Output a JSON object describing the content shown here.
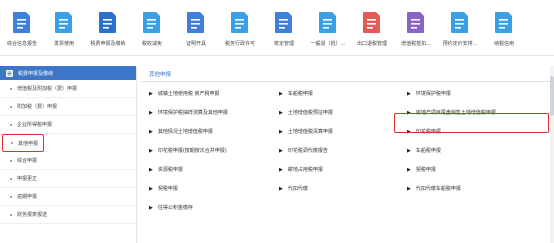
{
  "toolbar": {
    "items": [
      {
        "label": "综合信息报告",
        "color": "#3d7fd9",
        "icon": "doc-upload-icon"
      },
      {
        "label": "发票使用",
        "color": "#3aa0e6",
        "icon": "invoice-icon"
      },
      {
        "label": "税费申报及缴纳",
        "color": "#2d6fcc",
        "icon": "tax-declare-icon"
      },
      {
        "label": "税收减免",
        "color": "#3aa0e6",
        "icon": "tax-reduce-icon"
      },
      {
        "label": "证明开具",
        "color": "#3d7fd9",
        "icon": "certificate-icon"
      },
      {
        "label": "税务行政许可",
        "color": "#3aa0e6",
        "icon": "admin-permit-icon"
      },
      {
        "label": "核定管理",
        "color": "#3d7fd9",
        "icon": "approve-manage-icon"
      },
      {
        "label": "一般退（抵）...",
        "color": "#3aa0e6",
        "icon": "refund-icon"
      },
      {
        "label": "出口退税管理",
        "color": "#e25b54",
        "icon": "export-refund-icon"
      },
      {
        "label": "增值税抵扣...",
        "color": "#8a63c9",
        "icon": "vat-deduct-icon"
      },
      {
        "label": "预约定价安排...",
        "color": "#3aa0e6",
        "icon": "pricing-icon"
      },
      {
        "label": "纳税信用",
        "color": "#3aa0e6",
        "icon": "credit-icon"
      }
    ]
  },
  "sidebar": {
    "header": "税费申报及缴纳",
    "items": [
      {
        "label": "增值税及附加税（费）申报"
      },
      {
        "label": "附加税（费）申报"
      },
      {
        "label": "企业所得税申报"
      },
      {
        "label": "其他申报",
        "active": true
      },
      {
        "label": "综合申报"
      },
      {
        "label": "申报更正"
      },
      {
        "label": "逾期申报"
      },
      {
        "label": "财务报表报送"
      }
    ]
  },
  "main": {
    "header": "其他申报",
    "rows": [
      [
        "城镇土地使用税 房产税申报",
        "车船税申报",
        "环境保护税申报"
      ],
      [
        "环境保护税抽样测算及其他申报",
        "土地增值税预征申报",
        "房地产项目尾盘销售土地增值税申报"
      ],
      [
        "其他情况土地增值税申报",
        "土地增值税清算申报",
        "印花税申报"
      ],
      [
        "印花税申报(按期按次合并申报)",
        "印花税调代缴报告",
        "车船税申报"
      ],
      [
        "资源税申报",
        "耕地占用税申报",
        "契税申报"
      ],
      [
        "契税申报",
        "代扣代缴",
        "代扣代缴车船税申报"
      ],
      [
        "往得公积金缴存",
        "",
        ""
      ]
    ]
  },
  "colors": {
    "accent": "#3d76c8",
    "highlight": "#e0302d"
  }
}
